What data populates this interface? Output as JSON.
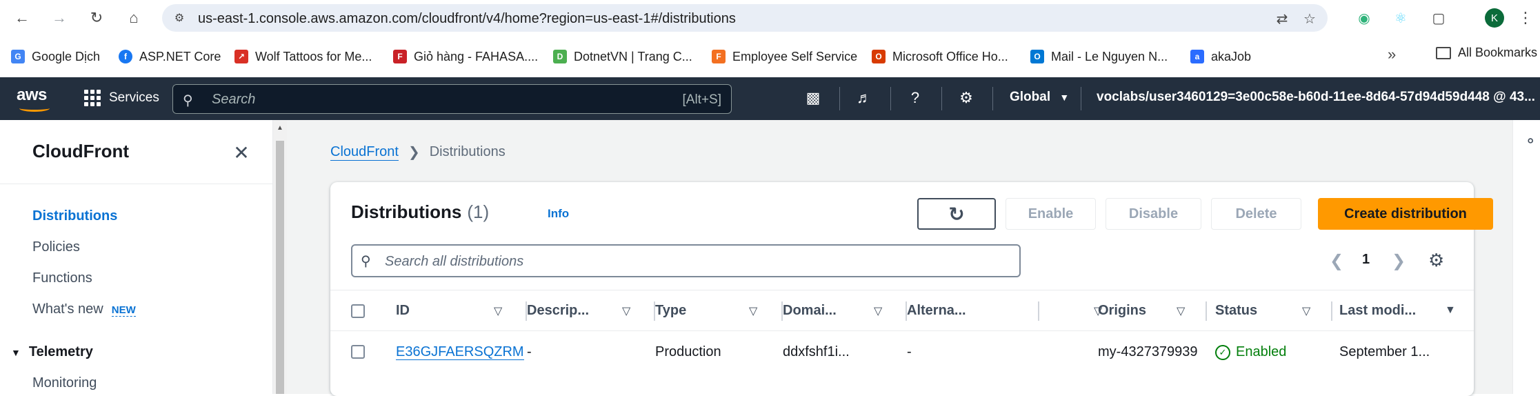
{
  "browser": {
    "url": "us-east-1.console.aws.amazon.com/cloudfront/v4/home?region=us-east-1#/distributions",
    "avatar_letter": "K",
    "bookmarks": [
      {
        "label": "Google Dịch",
        "icon": "google-translate-icon",
        "color": "#4285f4"
      },
      {
        "label": "ASP.NET Core",
        "icon": "facebook-icon",
        "color": "#1877f2"
      },
      {
        "label": "Wolf Tattoos for Me...",
        "icon": "wolf-tattoo-icon",
        "color": "#d93025"
      },
      {
        "label": "Giỏ hàng - FAHASA....",
        "icon": "fahasa-icon",
        "color": "#c92127"
      },
      {
        "label": "DotnetVN | Trang C...",
        "icon": "dotnetvn-icon",
        "color": "#4caf50"
      },
      {
        "label": "Employee Self Service",
        "icon": "fpt-icon",
        "color": "#f37021"
      },
      {
        "label": "Microsoft Office Ho...",
        "icon": "office-icon",
        "color": "#d83b01"
      },
      {
        "label": "Mail - Le Nguyen N...",
        "icon": "outlook-icon",
        "color": "#0078d4"
      },
      {
        "label": "akaJob",
        "icon": "akajob-icon",
        "color": "#2b6cff"
      }
    ],
    "more_label": "»",
    "all_bookmarks": "All Bookmarks"
  },
  "aws": {
    "logo": "aws",
    "services": "Services",
    "search_placeholder": "Search",
    "search_shortcut": "[Alt+S]",
    "region": "Global",
    "account": "voclabs/user3460129=3e00c58e-b60d-11ee-8d64-57d94d59d448 @ 43..."
  },
  "sidenav": {
    "title": "CloudFront",
    "items": [
      {
        "label": "Distributions",
        "active": true
      },
      {
        "label": "Policies",
        "active": false
      },
      {
        "label": "Functions",
        "active": false
      },
      {
        "label": "What's new",
        "active": false
      }
    ],
    "new_badge": "NEW",
    "section": "Telemetry",
    "section_items": [
      "Monitoring"
    ]
  },
  "breadcrumb": {
    "root": "CloudFront",
    "current": "Distributions"
  },
  "distributions": {
    "title": "Distributions",
    "count": "(1)",
    "info": "Info",
    "buttons": {
      "enable": "Enable",
      "disable": "Disable",
      "delete": "Delete",
      "create": "Create distribution"
    },
    "filter_placeholder": "Search all distributions",
    "page": "1",
    "columns": [
      "ID",
      "Descrip...",
      "Type",
      "Domai...",
      "Alterna...",
      "Origins",
      "Status",
      "Last modi..."
    ],
    "rows": [
      {
        "id": "E36GJFAERSQZRM",
        "description": "-",
        "type": "Production",
        "domain": "ddxfshf1i...",
        "alternate": "-",
        "origins": "my-4327379939",
        "status": "Enabled",
        "last_modified": "September 1..."
      }
    ]
  },
  "colors": {
    "aws_nav": "#232f3e",
    "accent_orange": "#ff9900",
    "link_blue": "#0972d3",
    "success_green": "#037f0c"
  }
}
